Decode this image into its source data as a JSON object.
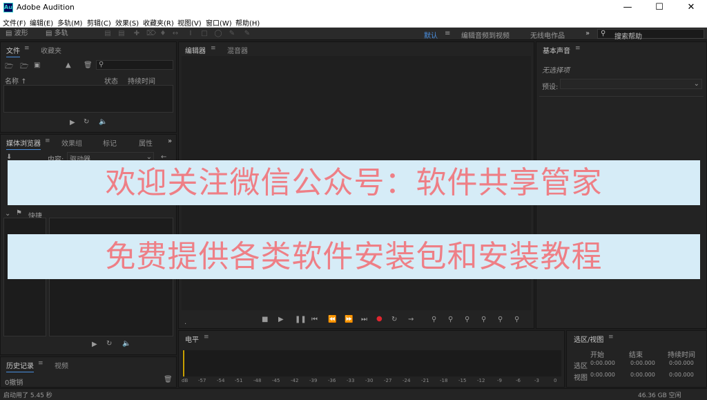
{
  "window": {
    "title": "Adobe Audition",
    "icon_text": "Au"
  },
  "menu": [
    "文件(F)",
    "编辑(E)",
    "多轨(M)",
    "剪辑(C)",
    "效果(S)",
    "收藏夹(R)",
    "视图(V)",
    "窗口(W)",
    "帮助(H)"
  ],
  "toolbar": {
    "waveform_label": "波形",
    "multitrack_label": "多轨",
    "workspaces": [
      "默认",
      "编辑音频到视频",
      "无线电作品"
    ],
    "search_placeholder": "搜索帮助"
  },
  "files_panel": {
    "tabs": [
      "文件",
      "收藏夹"
    ],
    "columns": [
      "名称",
      "状态",
      "持续时间"
    ]
  },
  "media_panel": {
    "tabs": [
      "媒体浏览器",
      "效果组",
      "标记",
      "属性"
    ],
    "content_label": "内容:",
    "content_value": "驱动器",
    "shortcut_label": "快捷"
  },
  "history_panel": {
    "tabs": [
      "历史记录",
      "视频"
    ],
    "undo_text": "0撤销"
  },
  "editor_panel": {
    "tabs": [
      "编辑器",
      "混音器"
    ]
  },
  "essential_sound": {
    "title": "基本声音",
    "no_selection": "无选择项",
    "preset_label": "预设:"
  },
  "levels_panel": {
    "title": "电平",
    "ticks": [
      "dB",
      "-57",
      "-54",
      "-51",
      "-48",
      "-45",
      "-42",
      "-39",
      "-36",
      "-33",
      "-30",
      "-27",
      "-24",
      "-21",
      "-18",
      "-15",
      "-12",
      "-9",
      "-6",
      "-3",
      "0"
    ]
  },
  "selection_panel": {
    "title": "选区/视图",
    "headers": [
      "开始",
      "结束",
      "持续时间"
    ],
    "rows": [
      {
        "label": "选区",
        "start": "0:00.000",
        "end": "0:00.000",
        "duration": "0:00.000"
      },
      {
        "label": "视图",
        "start": "0:00.000",
        "end": "0:00.000",
        "duration": "0:00.000"
      }
    ]
  },
  "status": {
    "left": "启动用了 5.45 秒",
    "right": "46.36 GB 空闲"
  },
  "overlay": {
    "line1": "欢迎关注微信公众号：软件共享管家",
    "line2": "免费提供各类软件安装包和安装教程"
  },
  "colors": {
    "accent": "#4a90e2",
    "record": "#e0262f",
    "banner_bg": "#d6ecf7",
    "banner_text": "#ee7f86"
  }
}
